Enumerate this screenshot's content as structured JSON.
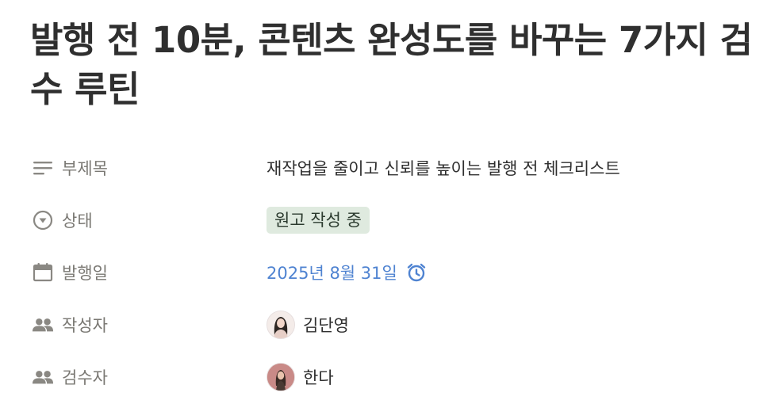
{
  "page": {
    "title": "발행 전 10분, 콘텐츠 완성도를 바꾸는 7가지 검수 루틴"
  },
  "properties": [
    {
      "id": "subtitle",
      "name": "부제목",
      "icon": "text-lines-icon",
      "value": "재작업을 줄이고 신뢰를 높이는 발행 전 체크리스트"
    },
    {
      "id": "status",
      "name": "상태",
      "icon": "status-circle-icon",
      "value": "원고 작성 중",
      "color": "#dfeadf"
    },
    {
      "id": "publish-date",
      "name": "발행일",
      "icon": "calendar-icon",
      "value": "2025년 8월 31일",
      "color": "#4f83d1",
      "extra_icon": "alarm-clock-icon"
    },
    {
      "id": "author",
      "name": "작성자",
      "icon": "people-icon",
      "value": "김단영",
      "avatar": "person-avatar"
    },
    {
      "id": "reviewer",
      "name": "검수자",
      "icon": "people-icon",
      "value": "한다",
      "avatar": "person-avatar"
    }
  ],
  "colors": {
    "label": "#7a7873",
    "date": "#4f83d1",
    "status_tag_bg": "#dfeadf"
  }
}
